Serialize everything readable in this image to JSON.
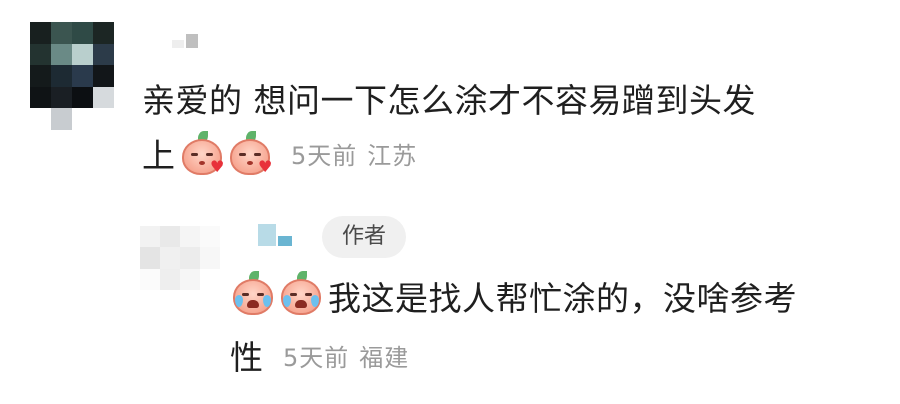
{
  "comment": {
    "line1": "亲爱的 想问一下怎么涂才不容易蹭到头发",
    "line2": "上",
    "emojis": [
      "kiss-heart-emoji",
      "kiss-heart-emoji"
    ],
    "time": "5天前",
    "location": "江苏"
  },
  "reply": {
    "badge": "作者",
    "emojis": [
      "crying-emoji",
      "crying-emoji"
    ],
    "line1": "我这是找人帮忙涂的，没啥参考",
    "line2": "性",
    "time": "5天前",
    "location": "福建"
  },
  "colors": {
    "text": "#1f1f1f",
    "meta": "#9a9a9a",
    "badge_bg": "#f0f0f0",
    "badge_text": "#4a4a4a"
  }
}
